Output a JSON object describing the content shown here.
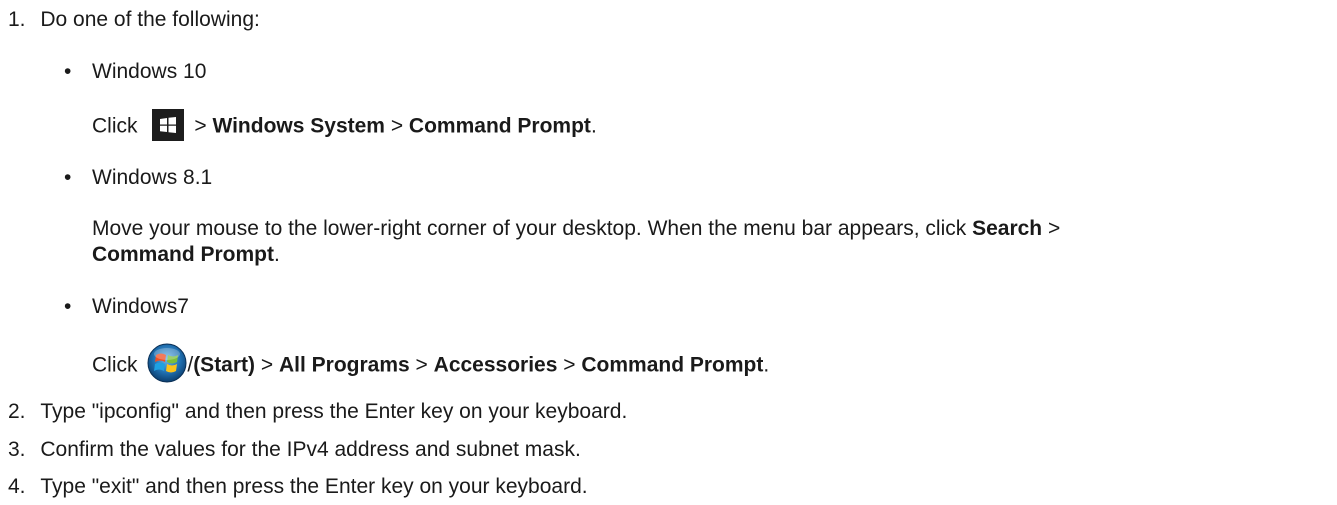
{
  "steps": [
    {
      "number": "1.",
      "text": "Do one of the following:",
      "options": [
        {
          "label": "Windows 10",
          "click": "Click",
          "sep": ">",
          "path1": "Windows System",
          "path2": "Command Prompt",
          "end": "."
        },
        {
          "label": "Windows 8.1",
          "text_a": "Move your mouse to the lower-right corner of your desktop. When the menu bar appears, click",
          "search": "Search",
          "sep": ">",
          "path": "Command Prompt",
          "end": "."
        },
        {
          "label": "Windows7",
          "click": "Click",
          "slash": "/",
          "start": "(Start)",
          "sep": ">",
          "path1": "All Programs",
          "path2": "Accessories",
          "path3": "Command Prompt",
          "end": "."
        }
      ]
    },
    {
      "number": "2.",
      "text": "Type \"ipconfig\" and then press the Enter key on your keyboard."
    },
    {
      "number": "3.",
      "text": "Confirm the values for the IPv4 address and subnet mask."
    },
    {
      "number": "4.",
      "text": "Type \"exit\" and then press the Enter key on your keyboard."
    }
  ],
  "bullet_char": "•",
  "icons": {
    "win10": "windows-10-start-icon",
    "win7": "windows-7-start-orb-icon"
  }
}
